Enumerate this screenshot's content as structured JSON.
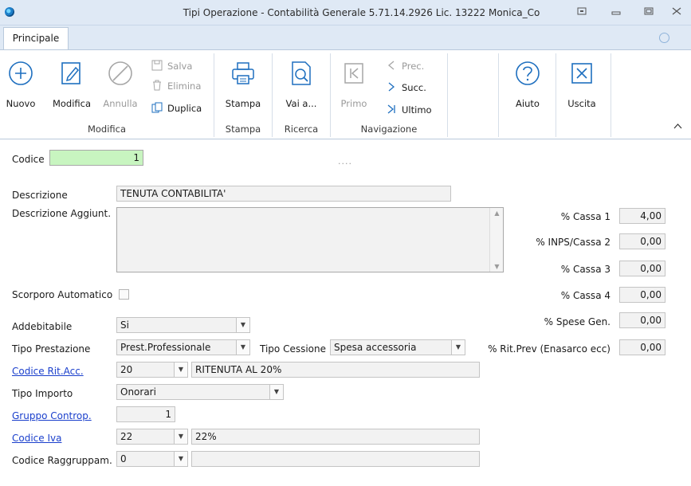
{
  "window": {
    "title": "Tipi Operazione - Contabilità Generale 5.71.14.2926 Lic. 13222 Monica_Co",
    "controls": [
      "restore-icon",
      "minimize-icon",
      "maximize-icon",
      "close-icon"
    ]
  },
  "tabs": [
    {
      "label": "Principale",
      "active": true
    }
  ],
  "ribbon": {
    "groups": {
      "modifica": "Modifica",
      "stampa": "Stampa",
      "ricerca": "Ricerca",
      "navigazione": "Navigazione"
    },
    "buttons": {
      "nuovo": "Nuovo",
      "modifica": "Modifica",
      "annulla": "Annulla",
      "salva": "Salva",
      "elimina": "Elimina",
      "duplica": "Duplica",
      "stampa": "Stampa",
      "vai": "Vai a...",
      "primo": "Primo",
      "prec": "Prec.",
      "succ": "Succ.",
      "ultimo": "Ultimo",
      "aiuto": "Aiuto",
      "uscita": "Uscita"
    }
  },
  "form": {
    "codice": {
      "label": "Codice",
      "value": "1"
    },
    "descrizione": {
      "label": "Descrizione",
      "value": "TENUTA CONTABILITA'"
    },
    "descrizione_agg": {
      "label": "Descrizione Aggiunt.",
      "value": ""
    },
    "scorporo": {
      "label": "Scorporo Automatico",
      "checked": false
    },
    "addebitabile": {
      "label": "Addebitabile",
      "value": "Si"
    },
    "tipo_prestazione": {
      "label": "Tipo Prestazione",
      "value": "Prest.Professionale"
    },
    "tipo_cessione": {
      "label": "Tipo Cessione",
      "value": "Spesa accessoria"
    },
    "codice_rit": {
      "label": "Codice Rit.Acc.",
      "value": "20",
      "desc": "RITENUTA AL 20%"
    },
    "tipo_importo": {
      "label": "Tipo Importo",
      "value": "Onorari"
    },
    "gruppo_controp": {
      "label": "Gruppo Controp.",
      "value": "1"
    },
    "codice_iva": {
      "label": "Codice Iva",
      "value": "22",
      "desc": "22%"
    },
    "codice_raggr": {
      "label": "Codice Raggruppam.",
      "value": "0",
      "desc": ""
    }
  },
  "percent": {
    "cassa1": {
      "label": "% Cassa 1",
      "value": "4,00"
    },
    "inps": {
      "label": "% INPS/Cassa 2",
      "value": "0,00"
    },
    "cassa3": {
      "label": "% Cassa 3",
      "value": "0,00"
    },
    "cassa4": {
      "label": "% Cassa 4",
      "value": "0,00"
    },
    "spese": {
      "label": "% Spese Gen.",
      "value": "0,00"
    },
    "ritprev": {
      "label": "% Rit.Prev (Enasarco ecc)",
      "value": "0,00"
    }
  }
}
